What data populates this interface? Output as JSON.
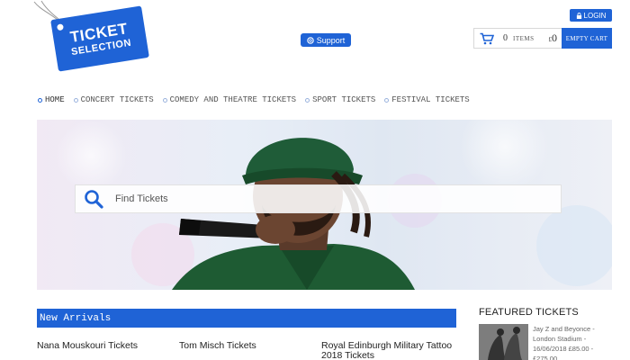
{
  "logo": {
    "line1": "TICKET",
    "line2": "SELECTION"
  },
  "support": {
    "label": "Support"
  },
  "login": {
    "label": "LOGIN"
  },
  "cart": {
    "count": "0",
    "items_label": "ITEMS",
    "currency": "£",
    "total": "0",
    "empty_label": "EMPTY CART"
  },
  "nav": [
    {
      "label": "HOME"
    },
    {
      "label": "CONCERT TICKETS"
    },
    {
      "label": "COMEDY AND THEATRE TICKETS"
    },
    {
      "label": "SPORT TICKETS"
    },
    {
      "label": "FESTIVAL TICKETS"
    }
  ],
  "search": {
    "placeholder": "Find Tickets"
  },
  "arrivals": {
    "title": "New Arrivals",
    "items": [
      {
        "label": "Nana Mouskouri Tickets"
      },
      {
        "label": "Tom Misch Tickets"
      },
      {
        "label": "Royal Edinburgh Military Tattoo 2018 Tickets"
      }
    ]
  },
  "featured": {
    "title": "FEATURED TICKETS",
    "item": {
      "text": "Jay Z and Beyonce - London Stadium - 16/06/2018 £85.00 - £275.00"
    }
  },
  "colors": {
    "brand": "#1f63d6"
  }
}
